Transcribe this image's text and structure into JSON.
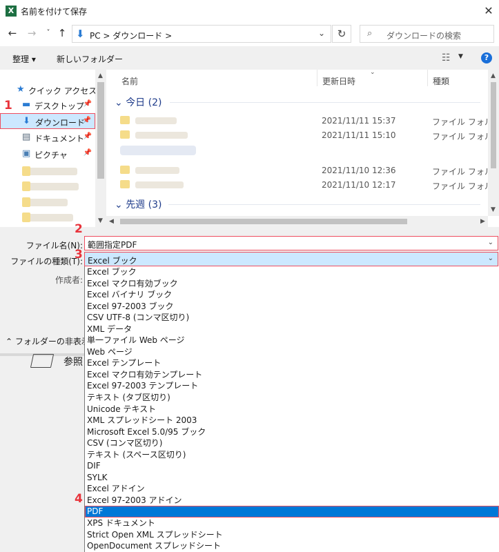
{
  "window": {
    "title": "名前を付けて保存",
    "app_icon": "X",
    "close_glyph": "✕"
  },
  "nav": {
    "back": "←",
    "forward": "→",
    "recent": "˅",
    "up": "↑",
    "address": "PC  >  ダウンロード  >",
    "refresh": "↻",
    "search_placeholder": "ダウンロードの検索"
  },
  "toolbar": {
    "organize": "整理 ▾",
    "new_folder": "新しいフォルダー",
    "help": "?"
  },
  "sidebar": {
    "quick_access": "クイック アクセス",
    "items": [
      {
        "label": "デスクトップ",
        "icon": "desktop-icon"
      },
      {
        "label": "ダウンロード",
        "icon": "download-icon"
      },
      {
        "label": "ドキュメント",
        "icon": "document-icon"
      },
      {
        "label": "ピクチャ",
        "icon": "picture-icon"
      }
    ]
  },
  "files": {
    "columns": [
      "名前",
      "更新日時",
      "種類"
    ],
    "groups": [
      {
        "header": "今日 (2)"
      },
      {
        "header": "先週 (3)"
      }
    ],
    "rows": [
      {
        "date": "2021/11/11 15:37",
        "type": "ファイル フォルダー"
      },
      {
        "date": "2021/11/11 15:10",
        "type": "ファイル フォルダー"
      },
      {
        "date": "2021/11/10 12:36",
        "type": "ファイル フォルダー"
      },
      {
        "date": "2021/11/10 12:17",
        "type": "ファイル フォルダー"
      }
    ]
  },
  "form": {
    "filename_label": "ファイル名(N):",
    "filename_value": "範囲指定PDF",
    "filetype_label": "ファイルの種類(T):",
    "filetype_value": "Excel ブック",
    "author_label": "作成者:",
    "hide_folders": "フォルダーの非表示",
    "browse": "参照"
  },
  "filetype_options": [
    "Excel ブック",
    "Excel マクロ有効ブック",
    "Excel バイナリ ブック",
    "Excel 97-2003 ブック",
    "CSV UTF-8 (コンマ区切り)",
    "XML データ",
    "単一ファイル Web ページ",
    "Web ページ",
    "Excel テンプレート",
    "Excel マクロ有効テンプレート",
    "Excel 97-2003 テンプレート",
    "テキスト (タブ区切り)",
    "Unicode テキスト",
    "XML スプレッドシート 2003",
    "Microsoft Excel 5.0/95 ブック",
    "CSV (コンマ区切り)",
    "テキスト (スペース区切り)",
    "DIF",
    "SYLK",
    "Excel アドイン",
    "Excel 97-2003 アドイン",
    "PDF",
    "XPS ドキュメント",
    "Strict Open XML スプレッドシート",
    "OpenDocument スプレッドシート"
  ],
  "highlighted_option_index": 21,
  "steps": [
    "1",
    "2",
    "3",
    "4"
  ],
  "colors": {
    "accent": "#0078d7",
    "annotation": "#e8333b",
    "selection": "#cce8ff"
  }
}
